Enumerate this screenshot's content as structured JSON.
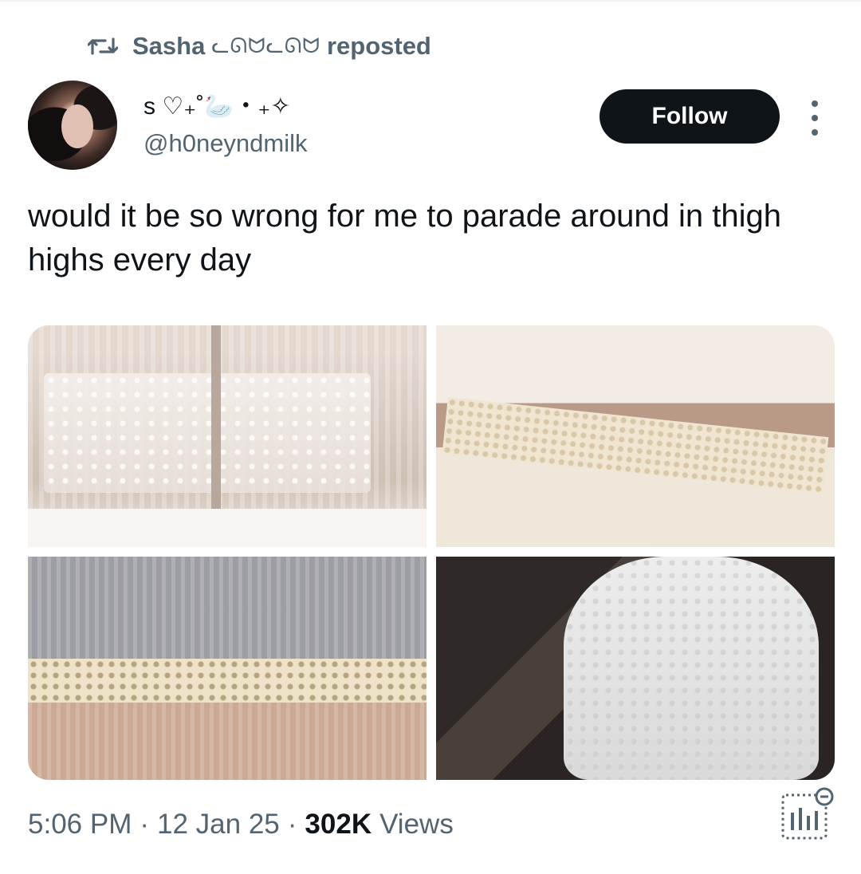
{
  "repost": {
    "icon": "repost-icon",
    "user_name": "Sasha",
    "user_emoji": "ᓚᘏᗢᓚᘏᗢ",
    "action_label": "reposted"
  },
  "tweet": {
    "author": {
      "display_name": "s ♡₊˚🦢・₊✧",
      "handle": "@h0neyndmilk",
      "avatar_icon": "avatar"
    },
    "follow_label": "Follow",
    "more_icon": "more-vertical-icon",
    "text": "would it be so wrong for me to parade around in thigh highs every day",
    "media": [
      {
        "alt": "white lace thigh highs"
      },
      {
        "alt": "cream knit thigh highs with lace trim"
      },
      {
        "alt": "grey ribbed socks with lace trim"
      },
      {
        "alt": "white lace knit stockings"
      }
    ],
    "time": "5:06 PM",
    "separator": "·",
    "date": "12 Jan 25",
    "views_count": "302K",
    "views_label": "Views",
    "stats_icon": "analytics-icon"
  },
  "colors": {
    "text_primary": "#0f1419",
    "text_secondary": "#536471",
    "follow_bg": "#0f1419",
    "background": "#ffffff"
  }
}
